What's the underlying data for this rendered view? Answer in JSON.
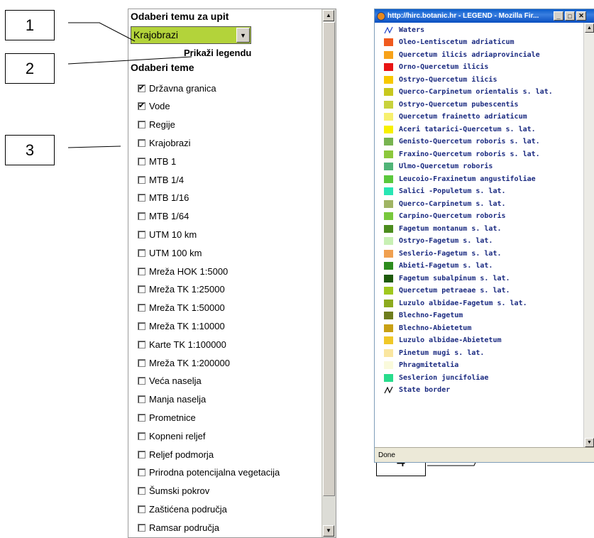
{
  "panel": {
    "heading_topic": "Odaberi temu za upit",
    "selected_topic": "Krajobrazi",
    "show_legend_label": "Prikaži legendu",
    "heading_themes": "Odaberi teme",
    "select_color": "#b3d33a",
    "themes": [
      {
        "label": "Državna granica",
        "checked": true
      },
      {
        "label": "Vode",
        "checked": true
      },
      {
        "label": "Regije",
        "checked": false
      },
      {
        "label": "Krajobrazi",
        "checked": false
      },
      {
        "label": "MTB 1",
        "checked": false
      },
      {
        "label": "MTB 1/4",
        "checked": false
      },
      {
        "label": "MTB 1/16",
        "checked": false
      },
      {
        "label": "MTB 1/64",
        "checked": false
      },
      {
        "label": "UTM 10 km",
        "checked": false
      },
      {
        "label": "UTM 100 km",
        "checked": false
      },
      {
        "label": "Mreža HOK 1:5000",
        "checked": false
      },
      {
        "label": "Mreža TK 1:25000",
        "checked": false
      },
      {
        "label": "Mreža TK 1:50000",
        "checked": false
      },
      {
        "label": "Mreža TK 1:10000",
        "checked": false
      },
      {
        "label": "Karte TK 1:100000",
        "checked": false
      },
      {
        "label": "Mreža TK 1:200000",
        "checked": false
      },
      {
        "label": "Veća naselja",
        "checked": false
      },
      {
        "label": "Manja naselja",
        "checked": false
      },
      {
        "label": "Prometnice",
        "checked": false
      },
      {
        "label": "Kopneni reljef",
        "checked": false
      },
      {
        "label": "Reljef podmorja",
        "checked": false
      },
      {
        "label": "Prirodna potencijalna vegetacija",
        "checked": false
      },
      {
        "label": "Šumski pokrov",
        "checked": false
      },
      {
        "label": "Zaštićena područja",
        "checked": false
      },
      {
        "label": "Ramsar područja",
        "checked": false
      }
    ]
  },
  "callouts": [
    "1",
    "2",
    "3",
    "4"
  ],
  "browser": {
    "title": "http://hirc.botanic.hr - LEGEND - Mozilla Fir...",
    "status": "Done",
    "legend": [
      {
        "label": "Waters",
        "kind": "line",
        "color": "#1a3fc8"
      },
      {
        "label": "Oleo-Lentiscetum adriaticum",
        "kind": "swatch",
        "color": "#f05a1e"
      },
      {
        "label": "Quercetum ilicis adriaprovinciale",
        "kind": "swatch",
        "color": "#f7a21a"
      },
      {
        "label": "Orno-Quercetum ilicis",
        "kind": "swatch",
        "color": "#e81414"
      },
      {
        "label": "Ostryo-Quercetum ilicis",
        "kind": "swatch",
        "color": "#f7c800"
      },
      {
        "label": "Querco-Carpinetum orientalis s. lat.",
        "kind": "swatch",
        "color": "#c8c81e"
      },
      {
        "label": "Ostryo-Quercetum pubescentis",
        "kind": "swatch",
        "color": "#c8d23c"
      },
      {
        "label": "Quercetum frainetto adriaticum",
        "kind": "swatch",
        "color": "#f7f06e"
      },
      {
        "label": "Aceri tatarici-Quercetum s. lat.",
        "kind": "swatch",
        "color": "#f7f000"
      },
      {
        "label": "Genisto-Quercetum roboris s. lat.",
        "kind": "swatch",
        "color": "#78b450"
      },
      {
        "label": "Fraxino-Quercetum roboris s. lat.",
        "kind": "swatch",
        "color": "#8cc83c"
      },
      {
        "label": "Ulmo-Quercetum roboris",
        "kind": "swatch",
        "color": "#50b478"
      },
      {
        "label": "Leucoio-Fraxinetum angustifoliae",
        "kind": "swatch",
        "color": "#5ac83c"
      },
      {
        "label": "Salici -Populetum s. lat.",
        "kind": "swatch",
        "color": "#28e6b4"
      },
      {
        "label": "Querco-Carpinetum s. lat.",
        "kind": "swatch",
        "color": "#a0b464"
      },
      {
        "label": "Carpino-Quercetum roboris",
        "kind": "swatch",
        "color": "#78c83c"
      },
      {
        "label": "Fagetum montanum s. lat.",
        "kind": "swatch",
        "color": "#4b8c1e"
      },
      {
        "label": "Ostryo-Fagetum s. lat.",
        "kind": "swatch",
        "color": "#c8f0b4"
      },
      {
        "label": "Seslerio-Fagetum s. lat.",
        "kind": "swatch",
        "color": "#f0a050"
      },
      {
        "label": "Abieti-Fagetum s. lat.",
        "kind": "swatch",
        "color": "#2d8c1e"
      },
      {
        "label": "Fagetum subalpinum s. lat.",
        "kind": "swatch",
        "color": "#1e5a0a"
      },
      {
        "label": "Quercetum petraeae s. lat.",
        "kind": "swatch",
        "color": "#a0c81e"
      },
      {
        "label": "Luzulo albidae-Fagetum s. lat.",
        "kind": "swatch",
        "color": "#8caa1e"
      },
      {
        "label": "Blechno-Fagetum",
        "kind": "swatch",
        "color": "#6e7d1e"
      },
      {
        "label": "Blechno-Abietetum",
        "kind": "swatch",
        "color": "#c8a014"
      },
      {
        "label": "Luzulo albidae-Abietetum",
        "kind": "swatch",
        "color": "#f0c828"
      },
      {
        "label": "Pinetum mugi s. lat.",
        "kind": "swatch",
        "color": "#fae6a0"
      },
      {
        "label": "Phragmitetalia",
        "kind": "swatch",
        "color": "#fafadc"
      },
      {
        "label": "Seslerion juncifoliae",
        "kind": "swatch",
        "color": "#28dc8c"
      },
      {
        "label": "State border",
        "kind": "line",
        "color": "#000000"
      }
    ]
  }
}
